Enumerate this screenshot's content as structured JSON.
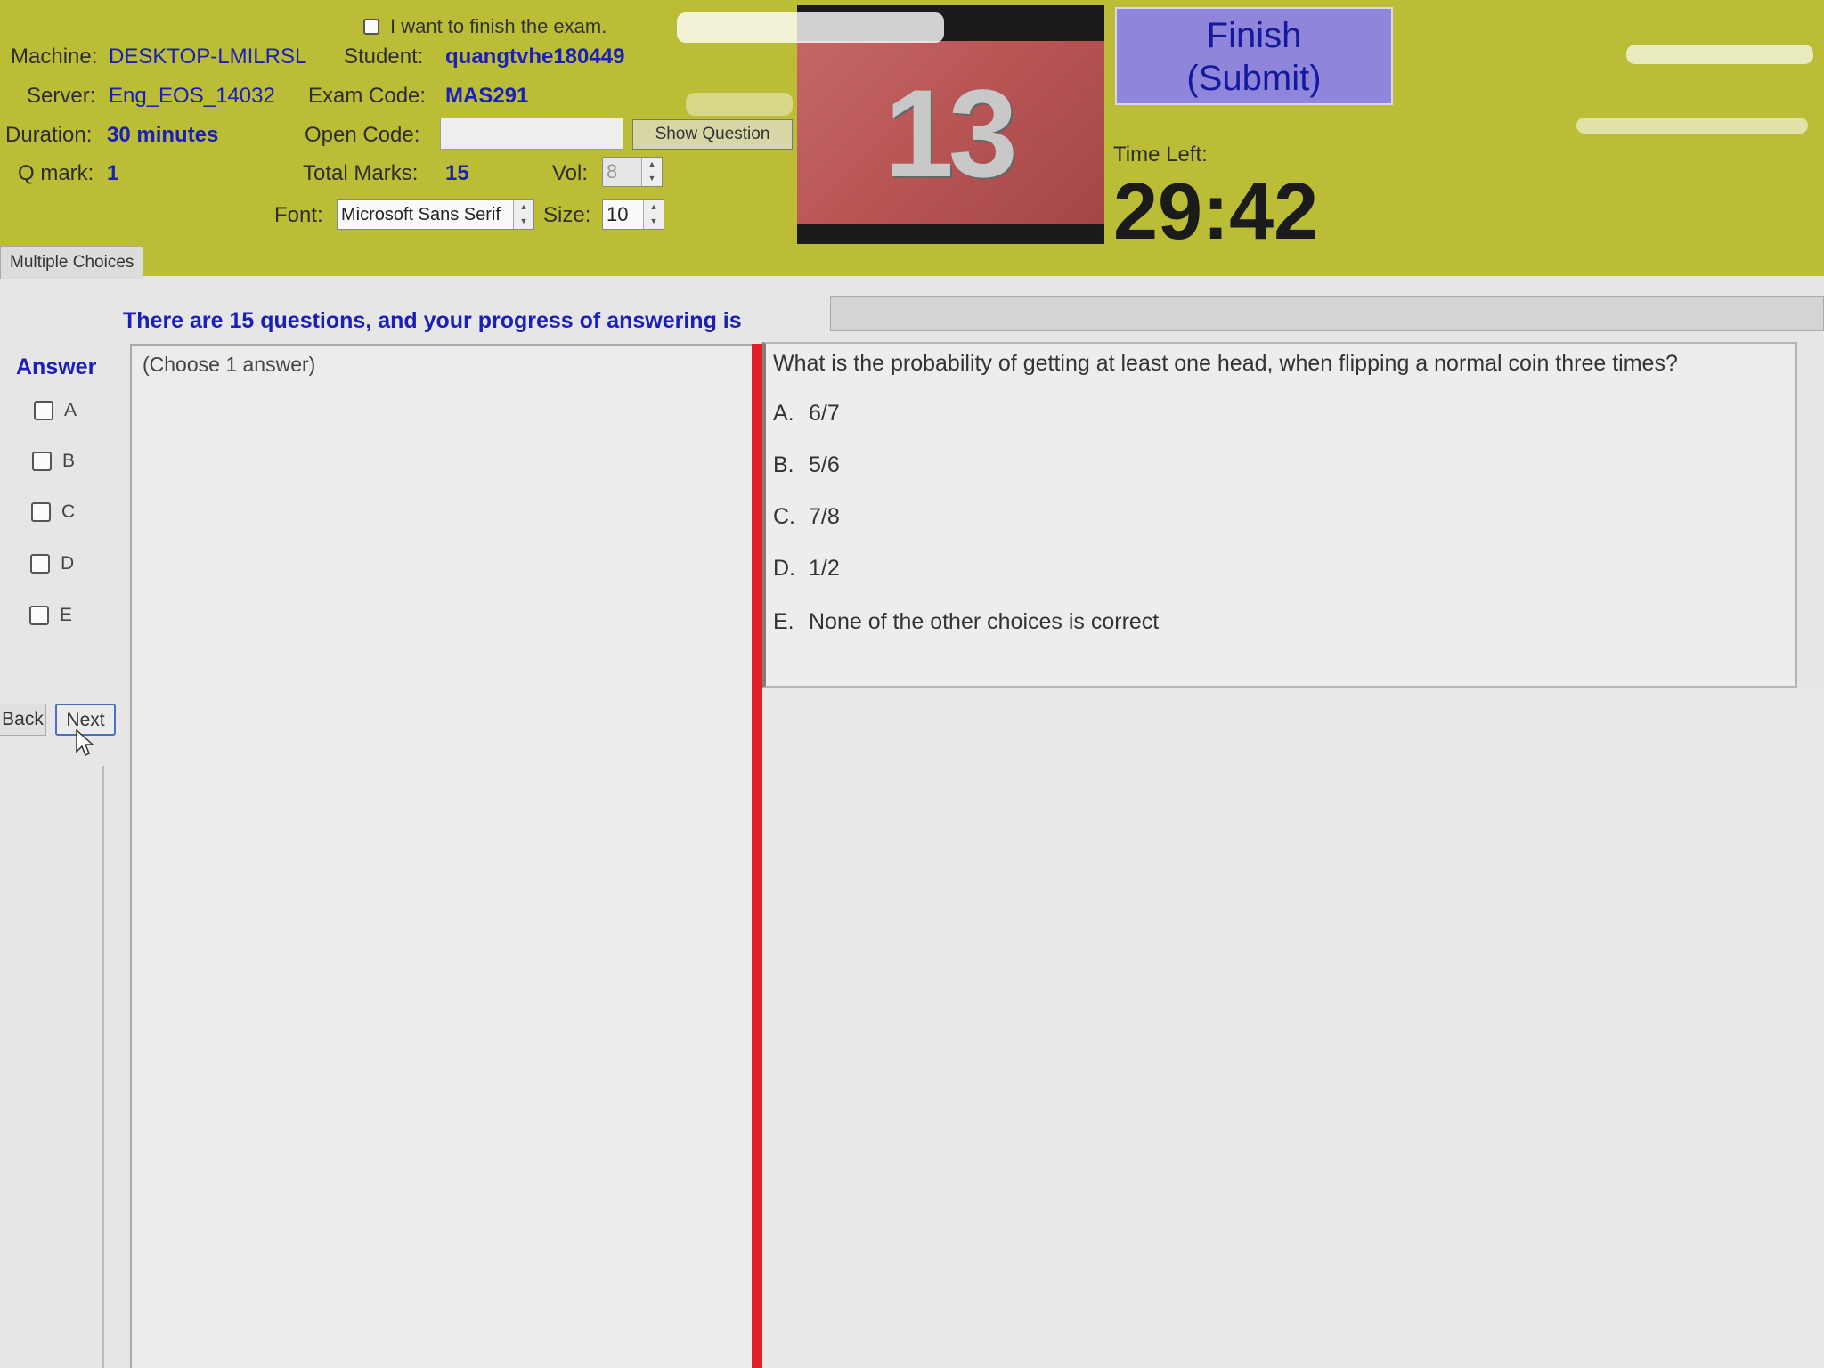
{
  "header": {
    "finish_checkbox_label": "I want to finish the exam.",
    "machine_label": "Machine:",
    "machine_value": "DESKTOP-LMILRSL",
    "student_label": "Student:",
    "student_value": "quangtvhe180449",
    "server_label": "Server:",
    "server_value": "Eng_EOS_14032",
    "exam_code_label": "Exam Code:",
    "exam_code_value": "MAS291",
    "duration_label": "Duration:",
    "duration_value": "30 minutes",
    "open_code_label": "Open Code:",
    "open_code_value": "",
    "show_question_label": "Show Question",
    "qmark_label": "Q mark:",
    "qmark_value": "1",
    "total_marks_label": "Total Marks:",
    "total_marks_value": "15",
    "vol_label": "Vol:",
    "vol_value": "8",
    "font_label": "Font:",
    "font_value": "Microsoft Sans Serif",
    "size_label": "Size:",
    "size_value": "10",
    "question_number": "13",
    "finish_button_line1": "Finish",
    "finish_button_line2": "(Submit)",
    "time_left_label": "Time Left:",
    "time_left_value": "29:42"
  },
  "tab": {
    "label": "Multiple Choices"
  },
  "progress": {
    "text": "There are 15 questions, and your progress of answering is",
    "fraction": 0
  },
  "answer": {
    "title": "Answer",
    "options": [
      "A",
      "B",
      "C",
      "D",
      "E"
    ],
    "back_label": "Back",
    "next_label": "Next"
  },
  "choose_hint": "(Choose 1 answer)",
  "question": {
    "text": "What is the probability of getting at least one head, when flipping a normal coin three times?",
    "options": [
      {
        "letter": "A.",
        "text": "6/7"
      },
      {
        "letter": "B.",
        "text": "5/6"
      },
      {
        "letter": "C.",
        "text": "7/8"
      },
      {
        "letter": "D.",
        "text": "1/2"
      },
      {
        "letter": "E.",
        "text": "None of the other choices is correct"
      }
    ]
  },
  "colors": {
    "header_bg": "#bcbd37",
    "value_blue": "#1a1fb6",
    "finish_button_bg": "#8f86db",
    "splitter_red": "#e11f26"
  }
}
